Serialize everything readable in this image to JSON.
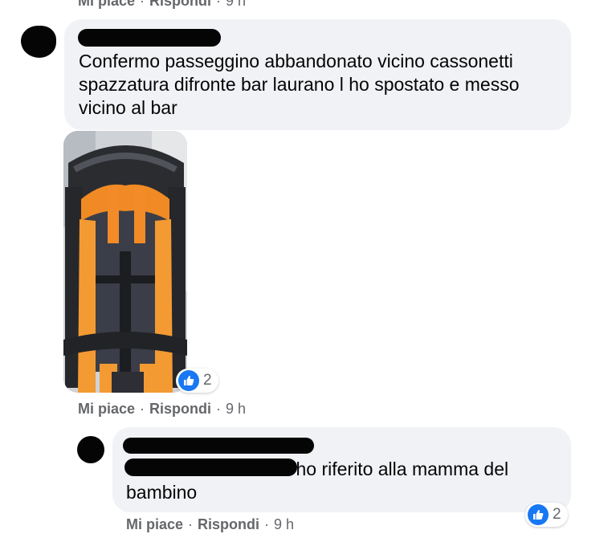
{
  "colors": {
    "bubble": "#f0f2f5",
    "meta_text": "#65676b",
    "like_blue": "#1877f2",
    "redaction": "#050505"
  },
  "top_actions": {
    "like": "Mi piace",
    "reply": "Rispondi",
    "time": "9 h"
  },
  "comment1": {
    "text": "Confermo passeggino abbandonato vicino cassonetti spazzatura difronte bar laurano l ho spostato e messo vicino al bar",
    "photo_icon": "stroller-photo",
    "reactions": {
      "icon": "like-icon",
      "count": "2"
    },
    "actions": {
      "like": "Mi piace",
      "reply": "Rispondi",
      "time": "9 h"
    }
  },
  "comment2": {
    "text_visible": "l'ho riferito alla mamma del bambino",
    "reactions": {
      "icon": "like-icon",
      "count": "2"
    },
    "actions": {
      "like": "Mi piace",
      "reply": "Rispondi",
      "time": "9 h"
    }
  }
}
